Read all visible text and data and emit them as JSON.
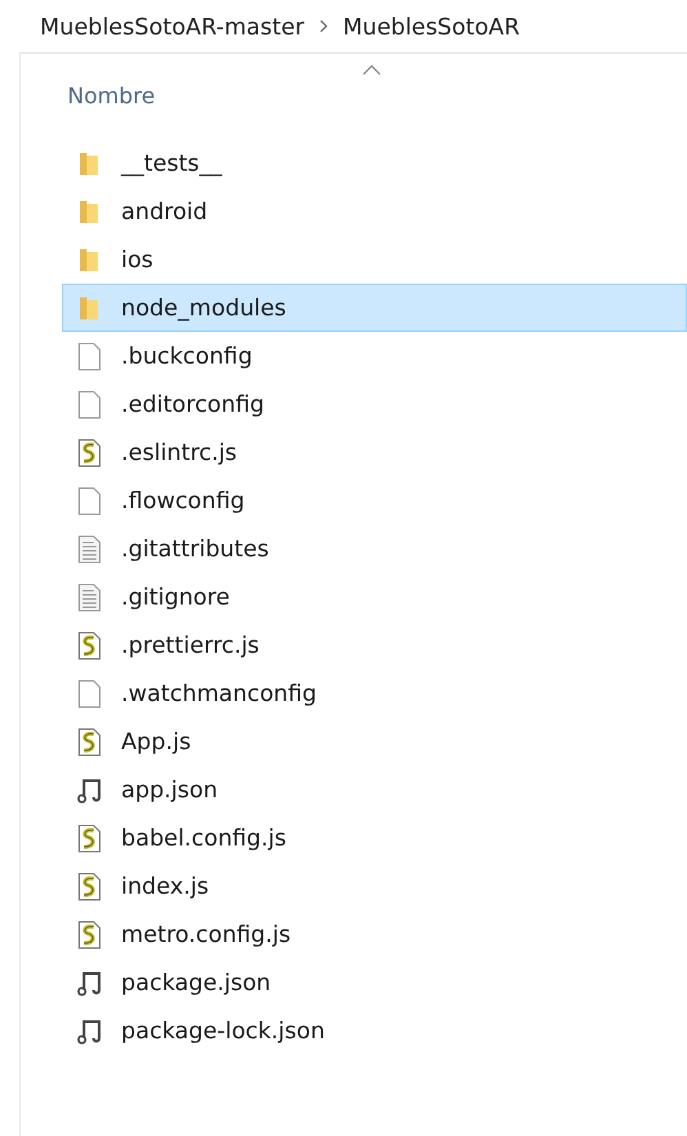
{
  "breadcrumb": [
    "MueblesSotoAR-master",
    "MueblesSotoAR"
  ],
  "column_header": {
    "label": "Nombre"
  },
  "files": [
    {
      "name": "__tests__",
      "kind": "folder",
      "selected": false
    },
    {
      "name": "android",
      "kind": "folder",
      "selected": false
    },
    {
      "name": "ios",
      "kind": "folder",
      "selected": false
    },
    {
      "name": "node_modules",
      "kind": "folder",
      "selected": true
    },
    {
      "name": ".buckconfig",
      "kind": "blank",
      "selected": false
    },
    {
      "name": ".editorconfig",
      "kind": "blank",
      "selected": false
    },
    {
      "name": ".eslintrc.js",
      "kind": "script",
      "selected": false
    },
    {
      "name": ".flowconfig",
      "kind": "blank",
      "selected": false
    },
    {
      "name": ".gitattributes",
      "kind": "text",
      "selected": false
    },
    {
      "name": ".gitignore",
      "kind": "text",
      "selected": false
    },
    {
      "name": ".prettierrc.js",
      "kind": "script",
      "selected": false
    },
    {
      "name": ".watchmanconfig",
      "kind": "blank",
      "selected": false
    },
    {
      "name": "App.js",
      "kind": "script",
      "selected": false
    },
    {
      "name": "app.json",
      "kind": "json",
      "selected": false
    },
    {
      "name": "babel.config.js",
      "kind": "script",
      "selected": false
    },
    {
      "name": "index.js",
      "kind": "script",
      "selected": false
    },
    {
      "name": "metro.config.js",
      "kind": "script",
      "selected": false
    },
    {
      "name": "package.json",
      "kind": "json",
      "selected": false
    },
    {
      "name": "package-lock.json",
      "kind": "json",
      "selected": false
    }
  ]
}
